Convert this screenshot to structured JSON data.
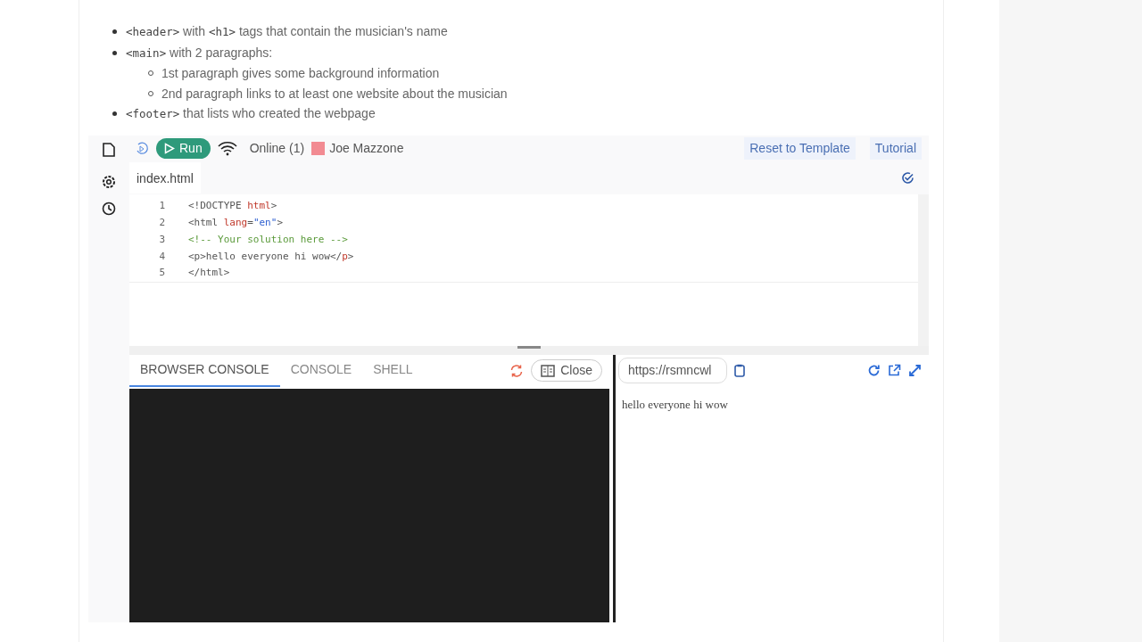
{
  "instructions": [
    {
      "code": "<header>",
      "text": " with ",
      "code2": "<h1>",
      "text2": " tags that contain the musician's name"
    },
    {
      "code": "<main>",
      "text": " with 2 paragraphs:",
      "children": [
        "1st paragraph gives some background information",
        "2nd paragraph links to at least one website about the musician"
      ]
    },
    {
      "code": "<footer>",
      "text": " that lists who created the webpage"
    }
  ],
  "toolbar": {
    "run": "Run",
    "status": "Online (1)",
    "user": {
      "name": "Joe Mazzone",
      "color": "#f28b92"
    },
    "links": [
      "Reset to Template",
      "Tutorial"
    ]
  },
  "file_tab": "index.html",
  "code_lines": [
    {
      "number": "1",
      "tokens": [
        {
          "kind": "punct",
          "text": "<!DOCTYPE "
        },
        {
          "kind": "tag",
          "text": "html"
        },
        {
          "kind": "punct",
          "text": ">"
        }
      ]
    },
    {
      "number": "2",
      "tokens": [
        {
          "kind": "punct",
          "text": "<html "
        },
        {
          "kind": "attr",
          "text": "lang"
        },
        {
          "kind": "punct",
          "text": "="
        },
        {
          "kind": "string",
          "text": "\"en\""
        },
        {
          "kind": "punct",
          "text": ">"
        }
      ]
    },
    {
      "number": "3",
      "tokens": [
        {
          "kind": "comment",
          "text": "<!-- Your solution here -->"
        }
      ]
    },
    {
      "number": "4",
      "tokens": [
        {
          "kind": "punct",
          "text": "<p>hello everyone hi wow</"
        },
        {
          "kind": "tag",
          "text": "p"
        },
        {
          "kind": "punct",
          "text": ">"
        }
      ]
    },
    {
      "number": "5",
      "tokens": [
        {
          "kind": "punct",
          "text": "</html>"
        }
      ]
    }
  ],
  "console_tabs": [
    {
      "label": "BROWSER CONSOLE",
      "selected": true
    },
    {
      "label": "CONSOLE",
      "selected": false
    },
    {
      "label": "SHELL",
      "selected": false
    }
  ],
  "close_button": "Close",
  "preview": {
    "url": "https://rsmncwl",
    "content": "hello everyone hi wow"
  }
}
